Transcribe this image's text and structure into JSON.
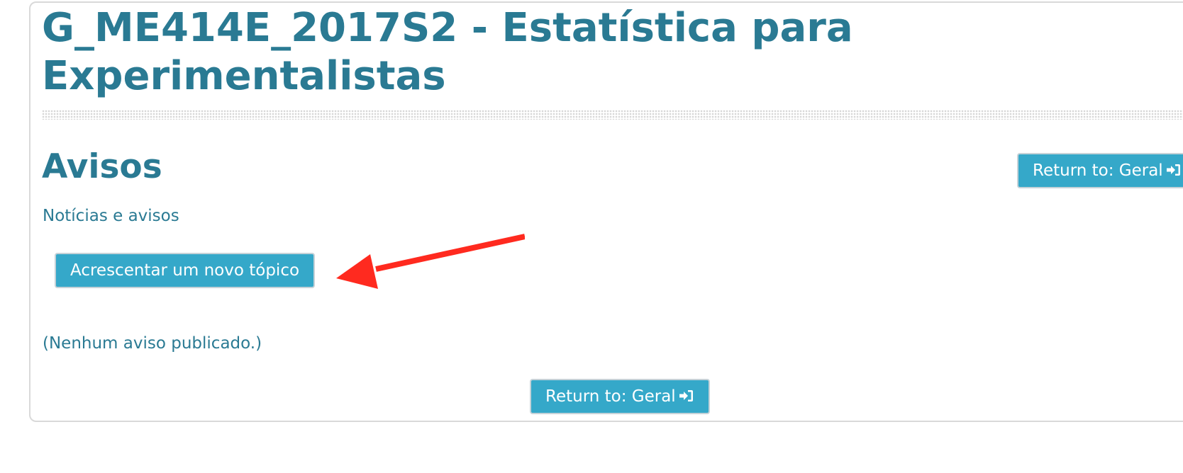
{
  "course": {
    "title": "G_ME414E_2017S2 - Estatística para Experimentalistas"
  },
  "forum": {
    "title": "Avisos",
    "description": "Notícias e avisos",
    "add_topic_label": "Acrescentar um novo tópico",
    "empty_message": "(Nenhum aviso publicado.)"
  },
  "navigation": {
    "return_label_top": "Return to: Geral",
    "return_label_bottom": "Return to: Geral",
    "return_icon": "sign-in-icon"
  },
  "annotation": {
    "arrow_color": "#ff2a1f",
    "points_to": "add-topic-button"
  },
  "colors": {
    "accent_text": "#2a7a93",
    "button_bg": "#35a8c9"
  }
}
